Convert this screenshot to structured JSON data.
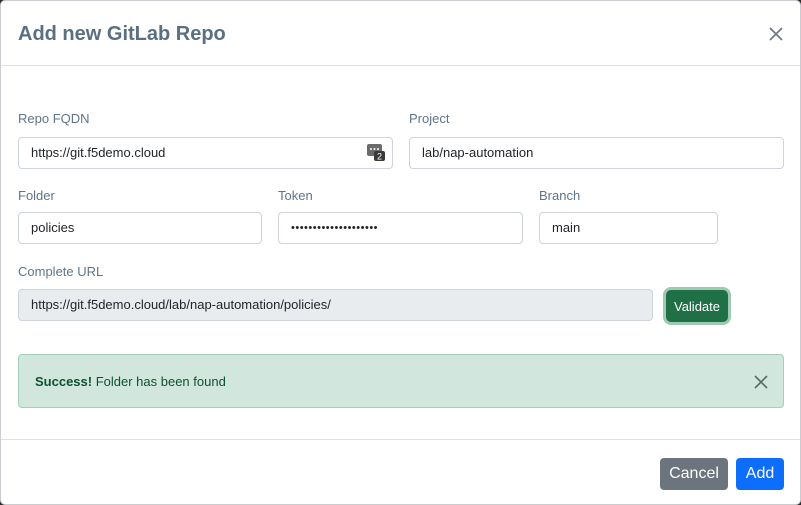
{
  "modal": {
    "title": "Add new GitLab Repo"
  },
  "form": {
    "repo_fqdn": {
      "label": "Repo FQDN",
      "value": "https://git.f5demo.cloud"
    },
    "project": {
      "label": "Project",
      "value": "lab/nap-automation"
    },
    "folder": {
      "label": "Folder",
      "value": "policies"
    },
    "token": {
      "label": "Token",
      "value": "••••••••••••••••••••"
    },
    "branch": {
      "label": "Branch",
      "value": "main"
    },
    "complete_url": {
      "label": "Complete URL",
      "value": "https://git.f5demo.cloud/lab/nap-automation/policies/"
    },
    "validate_label": "Validate"
  },
  "alert": {
    "strong": "Success!",
    "message": " Folder has been found"
  },
  "footer": {
    "cancel_label": "Cancel",
    "add_label": "Add"
  },
  "colors": {
    "title": "#5a6f82",
    "success_bg": "#d1e7dd",
    "validate": "#1f6f47",
    "primary": "#0d6efd",
    "secondary": "#6c757d"
  },
  "icons": {
    "close": "close-icon",
    "password_manager": "password-manager-icon"
  }
}
